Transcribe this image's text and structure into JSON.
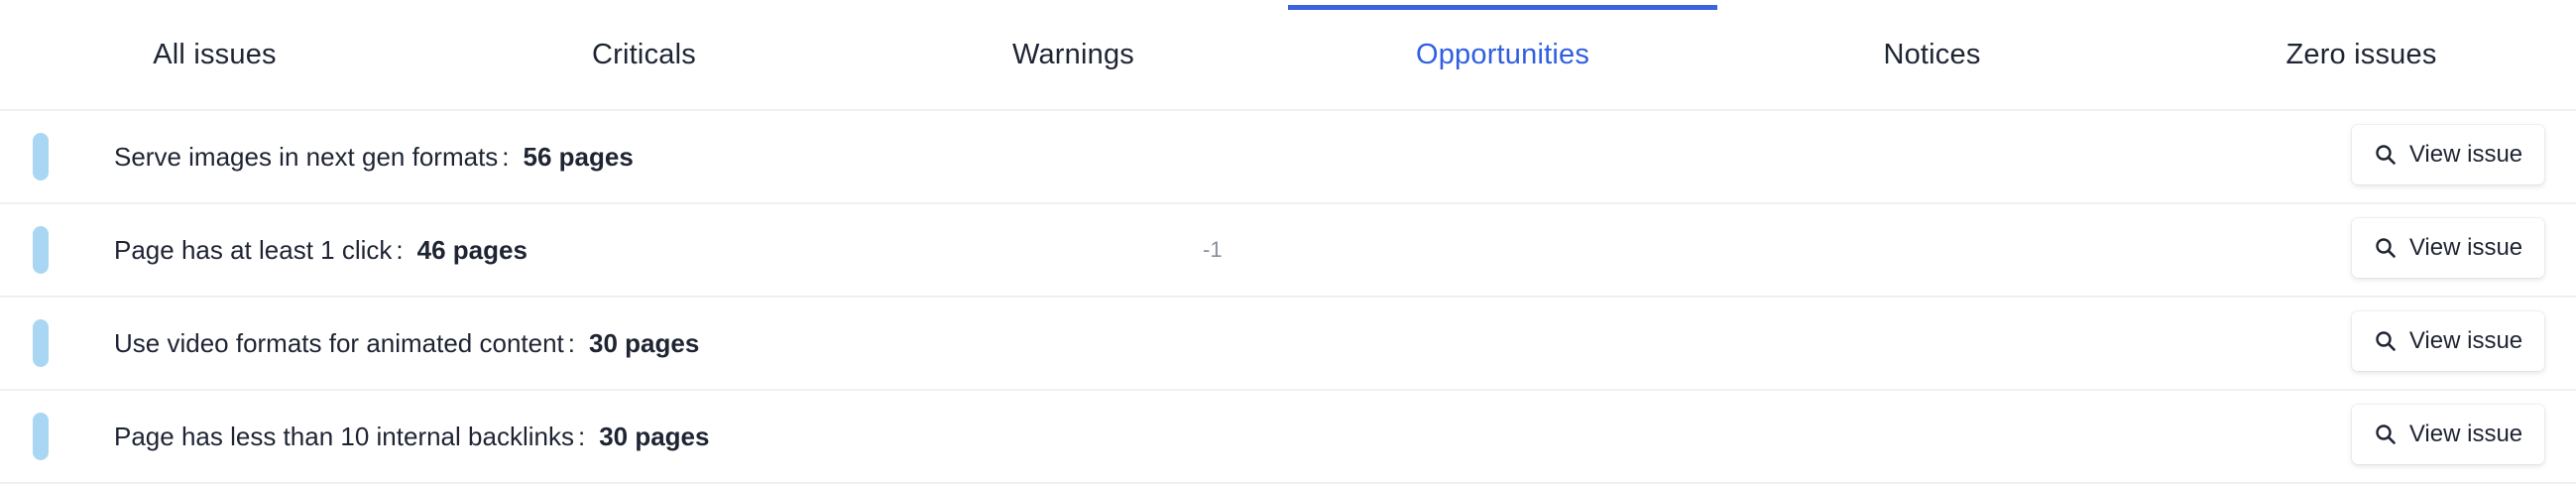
{
  "tabs": [
    {
      "label": "All issues",
      "active": false
    },
    {
      "label": "Criticals",
      "active": false
    },
    {
      "label": "Warnings",
      "active": false
    },
    {
      "label": "Opportunities",
      "active": true
    },
    {
      "label": "Notices",
      "active": false
    },
    {
      "label": "Zero issues",
      "active": false
    }
  ],
  "colors": {
    "accent": "#2f5fe0",
    "indicator": "#a9d7f3",
    "text": "#1f2433",
    "divider": "#eef0f3"
  },
  "rows": [
    {
      "title": "Serve images in next gen formats",
      "separator": ":",
      "count": "56 pages",
      "delta": "",
      "button_label": "View issue",
      "button_icon": "search-icon"
    },
    {
      "title": "Page has at least 1 click",
      "separator": ":",
      "count": "46 pages",
      "delta": "-1",
      "button_label": "View issue",
      "button_icon": "search-icon"
    },
    {
      "title": "Use video formats for animated content",
      "separator": ":",
      "count": "30 pages",
      "delta": "",
      "button_label": "View issue",
      "button_icon": "search-icon"
    },
    {
      "title": "Page has less than 10 internal backlinks",
      "separator": ":",
      "count": "30 pages",
      "delta": "",
      "button_label": "View issue",
      "button_icon": "search-icon"
    }
  ]
}
